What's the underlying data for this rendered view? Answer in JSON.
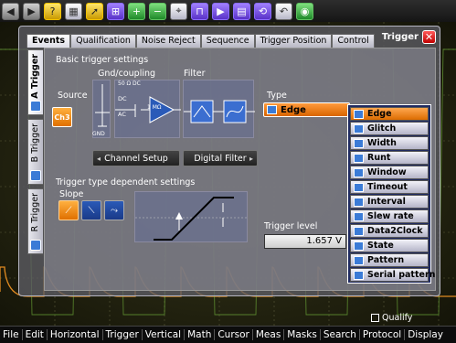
{
  "toolbar": {
    "buttons": [
      "back-icon",
      "forward-icon",
      "help-icon",
      "grid-icon",
      "pointer-icon",
      "zoom-icon",
      "zoom-in-icon",
      "zoom-out-icon",
      "measure-icon",
      "trigger-icon",
      "run-icon",
      "save-icon",
      "history-icon",
      "undo-icon",
      "spectrum-icon"
    ]
  },
  "menubar": {
    "items": [
      "File",
      "Edit",
      "Horizontal",
      "Trigger",
      "Vertical",
      "Math",
      "Cursor",
      "Meas",
      "Masks",
      "Search",
      "Protocol",
      "Display"
    ]
  },
  "dialog": {
    "title": "Trigger",
    "close_label": "✕",
    "tabs": [
      "Events",
      "Qualification",
      "Noise Reject",
      "Sequence",
      "Trigger Position",
      "Control"
    ],
    "side_tabs": [
      "A Trigger",
      "B Trigger",
      "R Trigger"
    ],
    "basic_settings_label": "Basic trigger settings",
    "gnd_coupling_label": "Gnd/coupling",
    "filter_label": "Filter",
    "type_label": "Type",
    "source_label": "Source",
    "source_value": "Ch3",
    "coupling_texts": {
      "z": "50 Ω DC",
      "dc": "DC",
      "ac": "AC",
      "mohm": "1 MΩ",
      "gnd": "GND"
    },
    "channel_setup_label": "Channel Setup",
    "digital_filter_label": "Digital Filter",
    "type_value": "Edge",
    "dependent_settings_label": "Trigger type dependent settings",
    "slope_label": "Slope",
    "trigger_level_label": "Trigger level",
    "trigger_level_value": "1.657 V",
    "type_options": [
      "Edge",
      "Glitch",
      "Width",
      "Runt",
      "Window",
      "Timeout",
      "Interval",
      "Slew rate",
      "Data2Clock",
      "State",
      "Pattern",
      "Serial pattern"
    ],
    "qualify_label": "Qualify"
  },
  "colors": {
    "accent_orange": "#ff8a20",
    "select_blue": "#3b7bd6",
    "waveform_orange": "#e08a20",
    "waveform_green": "#7ac040"
  }
}
